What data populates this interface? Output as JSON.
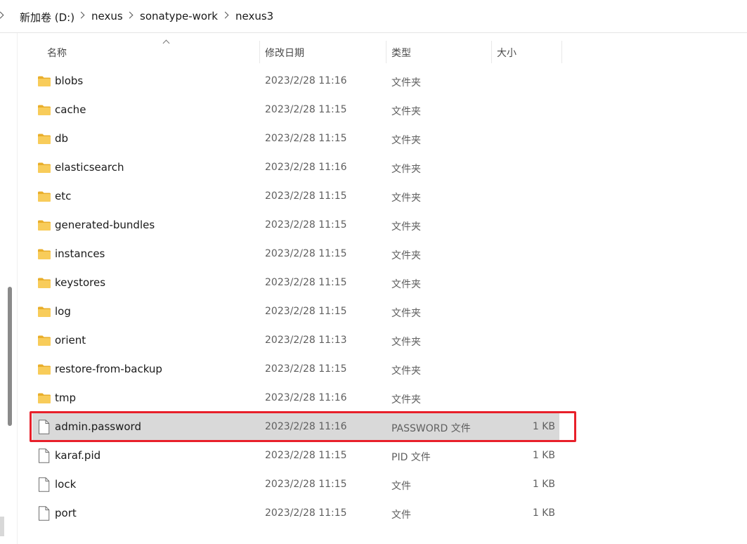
{
  "breadcrumb": {
    "items": [
      "新加卷 (D:)",
      "nexus",
      "sonatype-work",
      "nexus3"
    ]
  },
  "columns": {
    "name": "名称",
    "modified": "修改日期",
    "type": "类型",
    "size": "大小"
  },
  "files": [
    {
      "name": "blobs",
      "date": "2023/2/28 11:16",
      "type": "文件夹",
      "size": "",
      "icon": "folder-icon"
    },
    {
      "name": "cache",
      "date": "2023/2/28 11:15",
      "type": "文件夹",
      "size": "",
      "icon": "folder-icon"
    },
    {
      "name": "db",
      "date": "2023/2/28 11:15",
      "type": "文件夹",
      "size": "",
      "icon": "folder-icon"
    },
    {
      "name": "elasticsearch",
      "date": "2023/2/28 11:16",
      "type": "文件夹",
      "size": "",
      "icon": "folder-icon"
    },
    {
      "name": "etc",
      "date": "2023/2/28 11:15",
      "type": "文件夹",
      "size": "",
      "icon": "folder-icon"
    },
    {
      "name": "generated-bundles",
      "date": "2023/2/28 11:15",
      "type": "文件夹",
      "size": "",
      "icon": "folder-icon"
    },
    {
      "name": "instances",
      "date": "2023/2/28 11:15",
      "type": "文件夹",
      "size": "",
      "icon": "folder-icon"
    },
    {
      "name": "keystores",
      "date": "2023/2/28 11:15",
      "type": "文件夹",
      "size": "",
      "icon": "folder-icon"
    },
    {
      "name": "log",
      "date": "2023/2/28 11:15",
      "type": "文件夹",
      "size": "",
      "icon": "folder-icon"
    },
    {
      "name": "orient",
      "date": "2023/2/28 11:13",
      "type": "文件夹",
      "size": "",
      "icon": "folder-icon"
    },
    {
      "name": "restore-from-backup",
      "date": "2023/2/28 11:15",
      "type": "文件夹",
      "size": "",
      "icon": "folder-icon"
    },
    {
      "name": "tmp",
      "date": "2023/2/28 11:16",
      "type": "文件夹",
      "size": "",
      "icon": "folder-icon"
    },
    {
      "name": "admin.password",
      "date": "2023/2/28 11:16",
      "type": "PASSWORD 文件",
      "size": "1 KB",
      "icon": "file-icon",
      "selected": true
    },
    {
      "name": "karaf.pid",
      "date": "2023/2/28 11:15",
      "type": "PID 文件",
      "size": "1 KB",
      "icon": "file-icon"
    },
    {
      "name": "lock",
      "date": "2023/2/28 11:15",
      "type": "文件",
      "size": "1 KB",
      "icon": "file-icon"
    },
    {
      "name": "port",
      "date": "2023/2/28 11:15",
      "type": "文件",
      "size": "1 KB",
      "icon": "file-icon"
    }
  ],
  "colors": {
    "highlight": "#e8202a",
    "selected_row": "#d9d9d9",
    "folder": "#f4c44e"
  }
}
